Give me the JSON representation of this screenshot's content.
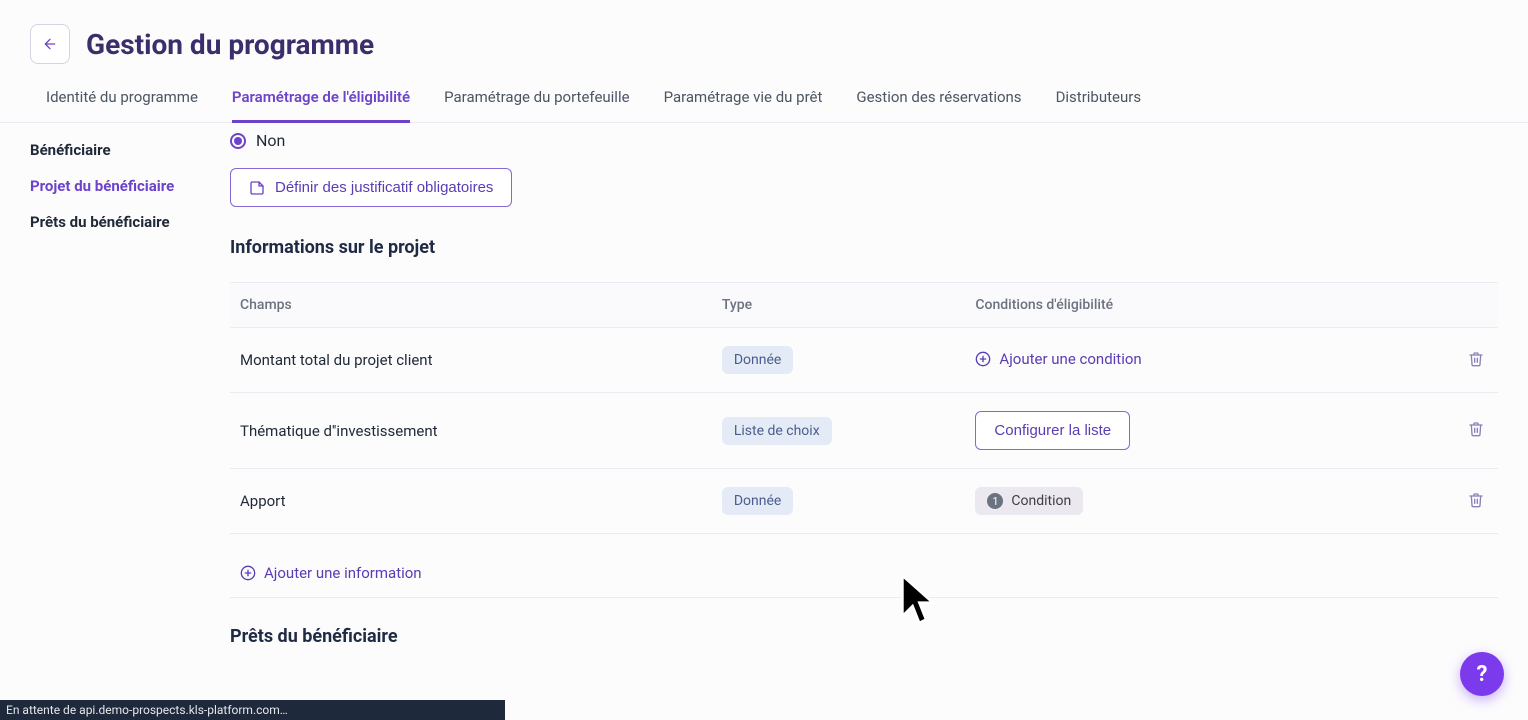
{
  "header": {
    "page_title": "Gestion du programme"
  },
  "tabs": [
    {
      "label": "Identité du programme"
    },
    {
      "label": "Paramétrage de l'éligibilité"
    },
    {
      "label": "Paramétrage du portefeuille"
    },
    {
      "label": "Paramétrage vie du prêt"
    },
    {
      "label": "Gestion des réservations"
    },
    {
      "label": "Distributeurs"
    }
  ],
  "sidebar": {
    "items": [
      {
        "label": "Bénéficiaire"
      },
      {
        "label": "Projet du bénéficiaire"
      },
      {
        "label": "Prêts du bénéficiaire"
      }
    ]
  },
  "radio": {
    "selected_label": "Non"
  },
  "buttons": {
    "define_docs": "Définir des justificatif obligatoires",
    "add_condition": "Ajouter une condition",
    "configure_list": "Configurer la liste",
    "add_info": "Ajouter une information"
  },
  "sections": {
    "project_info_title": "Informations sur le projet",
    "loans_title": "Prêts du bénéficiaire"
  },
  "table": {
    "headers": {
      "champs": "Champs",
      "type": "Type",
      "conditions": "Conditions d'éligibilité"
    },
    "rows": [
      {
        "champs": "Montant total du projet client",
        "type": "Donnée"
      },
      {
        "champs": "Thématique d''investissement",
        "type": "Liste de choix"
      },
      {
        "champs": "Apport",
        "type": "Donnée"
      }
    ]
  },
  "condition_badge": {
    "count": "1",
    "label": "Condition"
  },
  "status_bar": "En attente de api.demo-prospects.kls-platform.com…",
  "help": "?"
}
